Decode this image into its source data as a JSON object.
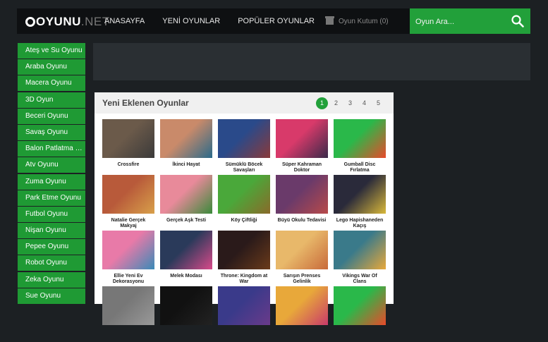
{
  "header": {
    "logo_text": "OYUNU",
    "logo_suffix": ".NET",
    "nav": [
      "ANASAYFA",
      "YENİ OYUNLAR",
      "POPÜLER OYUNLAR"
    ],
    "box_label": "Oyun Kutum (0)",
    "search_placeholder": "Oyun Ara..."
  },
  "sidebar": {
    "items": [
      "Ateş ve Su Oyunu",
      "Araba Oyunu",
      "Macera Oyunu",
      "3D Oyun",
      "Beceri Oyunu",
      "Savaş Oyunu",
      "Balon Patlatma Oyunu",
      "Atv Oyunu",
      "Zuma Oyunu",
      "Park Etme Oyunu",
      "Futbol Oyunu",
      "Nişan Oyunu",
      "Pepee Oyunu",
      "Robot Oyunu",
      "Zeka Oyunu",
      "Sue Oyunu"
    ]
  },
  "panel": {
    "title": "Yeni Eklenen Oyunlar",
    "pages": [
      "1",
      "2",
      "3",
      "4",
      "5"
    ],
    "games": [
      {
        "title": "Crossfire",
        "colors": [
          "#6b5a4a",
          "#3b3a3a"
        ]
      },
      {
        "title": "İkinci Hayat",
        "colors": [
          "#c98a6a",
          "#2a6a8a"
        ]
      },
      {
        "title": "Sümüklü Böcek Savaşları",
        "colors": [
          "#2a4a8a",
          "#8a3a3a"
        ]
      },
      {
        "title": "Süper Kahraman Doktor",
        "colors": [
          "#d83a6a",
          "#3a2a4a"
        ]
      },
      {
        "title": "Gumball Disc Fırlatma",
        "colors": [
          "#2ab84a",
          "#e84a2a"
        ]
      },
      {
        "title": "Natalie Gerçek Makyaj",
        "colors": [
          "#b85a3a",
          "#d8a04a"
        ]
      },
      {
        "title": "Gerçek Aşk Testi",
        "colors": [
          "#e88a9a",
          "#3a8a3a"
        ]
      },
      {
        "title": "Köy Çiftliği",
        "colors": [
          "#4aa83a",
          "#8a6a2a"
        ]
      },
      {
        "title": "Büyü Okulu Tedavisi",
        "colors": [
          "#6a3a6a",
          "#b84a4a"
        ]
      },
      {
        "title": "Lego Hapishaneden Kaçış",
        "colors": [
          "#2a2a3a",
          "#d8b83a"
        ]
      },
      {
        "title": "Ellie Yeni Ev Dekorasyonu",
        "colors": [
          "#e87aa8",
          "#3a8ab8"
        ]
      },
      {
        "title": "Melek Modası",
        "colors": [
          "#2a3a5a",
          "#d84a8a"
        ]
      },
      {
        "title": "Throne: Kingdom at War",
        "colors": [
          "#2a1a1a",
          "#6a3a1a"
        ]
      },
      {
        "title": "Sarışın Prenses Gelinlik",
        "colors": [
          "#e8b86a",
          "#c86a3a"
        ]
      },
      {
        "title": "Vikings War Of Clans",
        "colors": [
          "#3a7a8a",
          "#e8a83a"
        ]
      },
      {
        "title": "",
        "colors": [
          "#777777",
          "#999999"
        ]
      },
      {
        "title": "",
        "colors": [
          "#111111",
          "#222222"
        ]
      },
      {
        "title": "",
        "colors": [
          "#3a3a8a",
          "#6a3a8a"
        ]
      },
      {
        "title": "",
        "colors": [
          "#e8a83a",
          "#c83a6a"
        ]
      },
      {
        "title": "",
        "colors": [
          "#2ab84a",
          "#e84a2a"
        ]
      }
    ]
  }
}
